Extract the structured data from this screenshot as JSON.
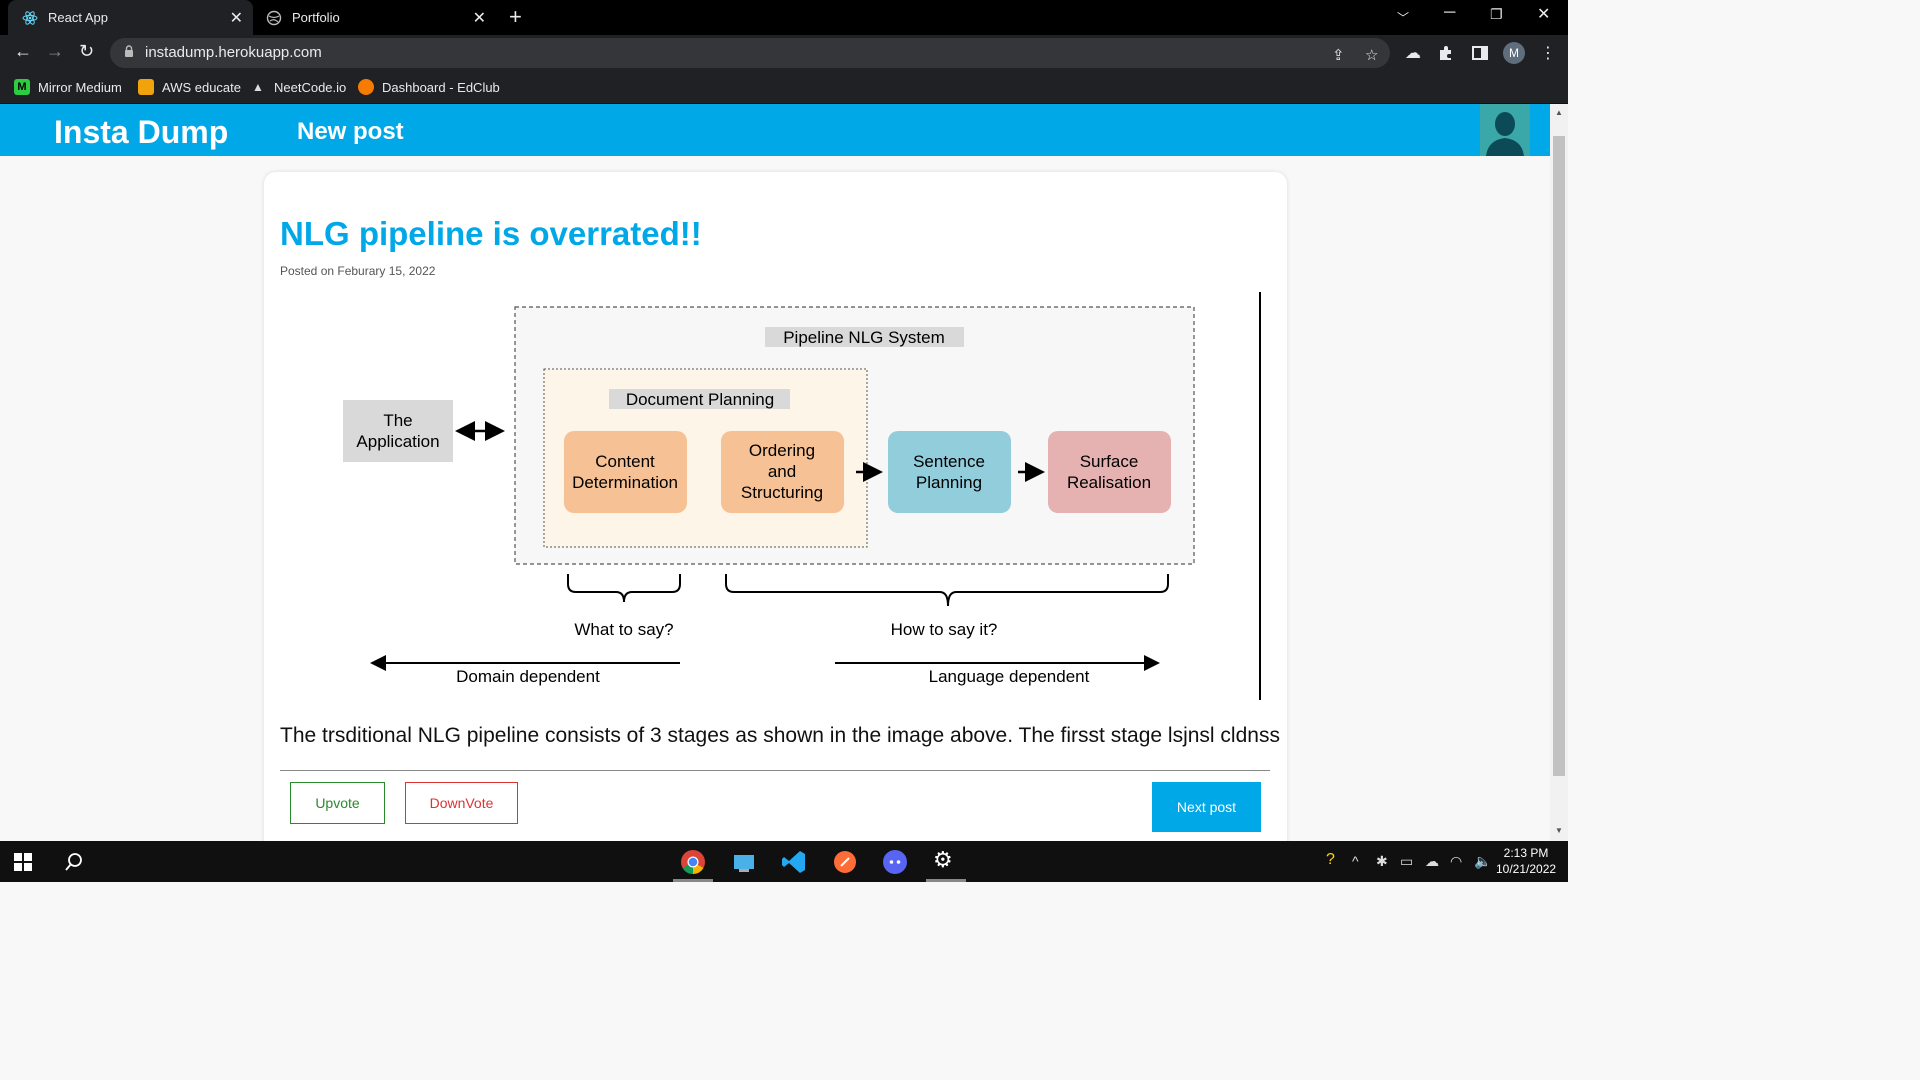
{
  "browser": {
    "tabs": [
      {
        "title": "React App",
        "active": true
      },
      {
        "title": "Portfolio",
        "active": false
      }
    ],
    "url": "instadump.herokuapp.com",
    "profile_initial": "M",
    "bookmarks": [
      {
        "label": "Mirror Medium",
        "icon": "medium-icon",
        "color": "#2ecc40"
      },
      {
        "label": "AWS educate",
        "icon": "aws-cube-icon",
        "color": "#f0a30a"
      },
      {
        "label": "NeetCode.io",
        "icon": "rocket-icon",
        "color": "#dddddd"
      },
      {
        "label": "Dashboard - EdClub",
        "icon": "edclub-icon",
        "color": "#f57c00"
      }
    ]
  },
  "app": {
    "brand": "Insta Dump",
    "nav_new_post": "New post",
    "accent_color": "#00a8e8"
  },
  "post": {
    "title": "NLG pipeline is overrated!!",
    "date": "Posted on Feburary 15, 2022",
    "body": "The trsditional NLG pipeline consists of 3 stages as shown in the image above. The firsst stage lsjnsl cldnss",
    "upvote_label": "Upvote",
    "downvote_label": "DownVote",
    "next_label": "Next post"
  },
  "diagram": {
    "system_label": "Pipeline NLG System",
    "doc_planning_label": "Document Planning",
    "application": [
      "The",
      "Application"
    ],
    "content_det": [
      "Content",
      "Determination"
    ],
    "ordering": [
      "Ordering",
      "and",
      "Structuring"
    ],
    "sentence": [
      "Sentence",
      "Planning"
    ],
    "surface": [
      "Surface",
      "Realisation"
    ],
    "what_to_say": "What to say?",
    "how_to_say": "How to say it?",
    "domain_dep": "Domain dependent",
    "language_dep": "Language dependent"
  },
  "taskbar": {
    "time": "2:13 PM",
    "date": "10/21/2022"
  }
}
